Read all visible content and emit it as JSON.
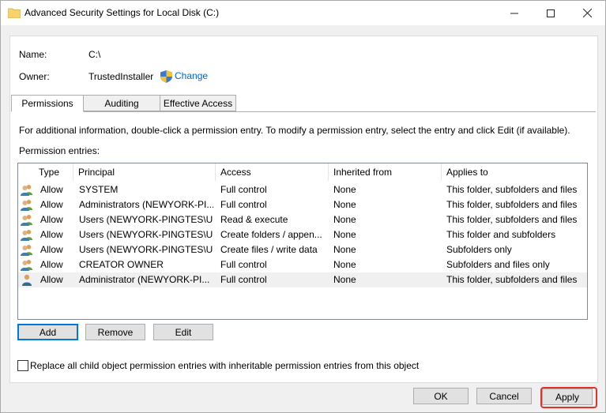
{
  "window": {
    "title": "Advanced Security Settings for Local Disk (C:)",
    "minimize": "—",
    "maximize": "☐",
    "close": "✕"
  },
  "info": {
    "name_label": "Name:",
    "name_value": "C:\\",
    "owner_label": "Owner:",
    "owner_value": "TrustedInstaller",
    "change_link": "Change"
  },
  "tabs": [
    {
      "label": "Permissions"
    },
    {
      "label": "Auditing"
    },
    {
      "label": "Effective Access"
    }
  ],
  "instructions": "For additional information, double-click a permission entry. To modify a permission entry, select the entry and click Edit (if available).",
  "entries_label": "Permission entries:",
  "columns": [
    "Type",
    "Principal",
    "Access",
    "Inherited from",
    "Applies to"
  ],
  "rows": [
    [
      "Allow",
      "SYSTEM",
      "Full control",
      "None",
      "This folder, subfolders and files"
    ],
    [
      "Allow",
      "Administrators (NEWYORK-PI...",
      "Full control",
      "None",
      "This folder, subfolders and files"
    ],
    [
      "Allow",
      "Users (NEWYORK-PINGTES\\U...",
      "Read & execute",
      "None",
      "This folder, subfolders and files"
    ],
    [
      "Allow",
      "Users (NEWYORK-PINGTES\\U...",
      "Create folders / appen...",
      "None",
      "This folder and subfolders"
    ],
    [
      "Allow",
      "Users (NEWYORK-PINGTES\\U...",
      "Create files / write data",
      "None",
      "Subfolders only"
    ],
    [
      "Allow",
      "CREATOR OWNER",
      "Full control",
      "None",
      "Subfolders and files only"
    ],
    [
      "Allow",
      "Administrator (NEWYORK-PI...",
      "Full control",
      "None",
      "This folder, subfolders and files"
    ]
  ],
  "row_icons": [
    "group-users-icon",
    "group-users-icon",
    "group-users-icon",
    "group-users-icon",
    "group-users-icon",
    "group-users-icon",
    "single-user-icon"
  ],
  "selected_row": 6,
  "buttons": {
    "add": "Add",
    "remove": "Remove",
    "edit": "Edit",
    "ok": "OK",
    "cancel": "Cancel",
    "apply": "Apply"
  },
  "replace_checkbox": {
    "label": "Replace all child object permission entries with inheritable permission entries from this object",
    "checked": false
  },
  "colors": {
    "link": "#0066cc",
    "highlight_ring": "#e0312e",
    "default_button_border": "#0078d7"
  }
}
